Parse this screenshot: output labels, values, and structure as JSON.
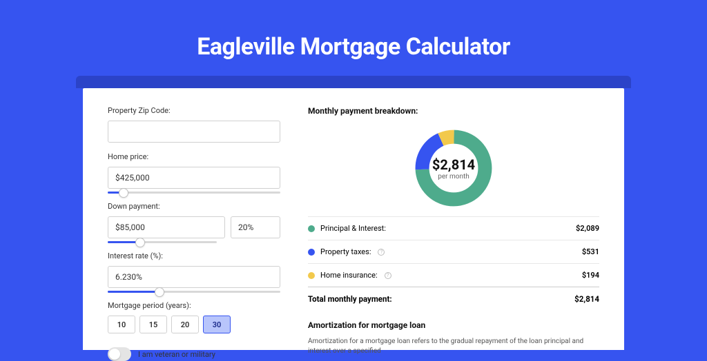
{
  "page_title": "Eagleville Mortgage Calculator",
  "form": {
    "zip": {
      "label": "Property Zip Code:",
      "value": ""
    },
    "home_price": {
      "label": "Home price:",
      "value": "$425,000",
      "slider_pct": 9
    },
    "down": {
      "label": "Down payment:",
      "amount": "$85,000",
      "pct": "20%",
      "slider_pct": 20
    },
    "rate": {
      "label": "Interest rate (%):",
      "value": "6.230%",
      "slider_pct": 30
    },
    "period": {
      "label": "Mortgage period (years):",
      "options": [
        "10",
        "15",
        "20",
        "30"
      ],
      "selected": "30"
    },
    "veteran": {
      "label": "I am veteran or military",
      "on": false
    }
  },
  "breakdown": {
    "title": "Monthly payment breakdown:",
    "center_amount": "$2,814",
    "center_sub": "per month",
    "items": [
      {
        "label": "Principal & Interest:",
        "value": "$2,089",
        "color": "green"
      },
      {
        "label": "Property taxes:",
        "value": "$531",
        "color": "blue",
        "info": true
      },
      {
        "label": "Home insurance:",
        "value": "$194",
        "color": "yellow",
        "info": true
      }
    ],
    "total_label": "Total monthly payment:",
    "total_value": "$2,814"
  },
  "chart_data": {
    "type": "pie",
    "title": "Monthly payment breakdown",
    "series": [
      {
        "name": "Principal & Interest",
        "value": 2089,
        "color": "#4eab8c"
      },
      {
        "name": "Property taxes",
        "value": 531,
        "color": "#3654f0"
      },
      {
        "name": "Home insurance",
        "value": 194,
        "color": "#f2c94c"
      }
    ],
    "center_label": "$2,814 per month"
  },
  "amort": {
    "title": "Amortization for mortgage loan",
    "text": "Amortization for a mortgage loan refers to the gradual repayment of the loan principal and interest over a specified"
  }
}
